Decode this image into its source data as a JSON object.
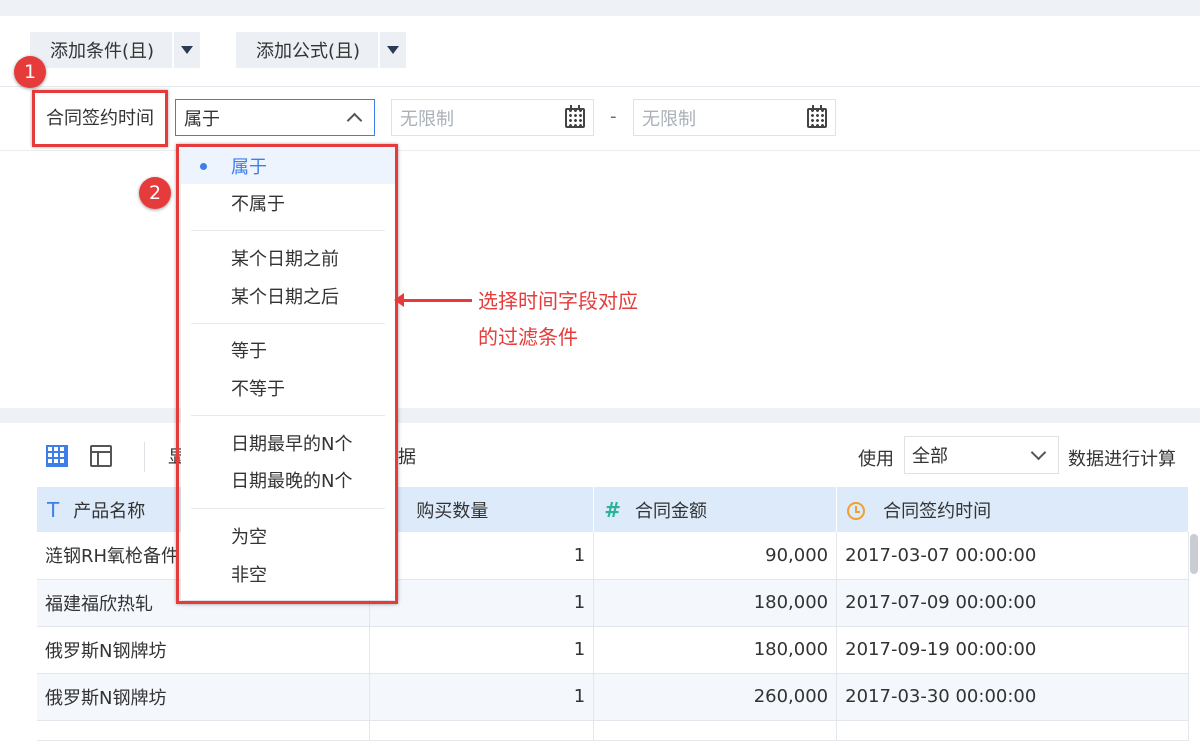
{
  "filter": {
    "add_condition_label": "添加条件(且)",
    "add_formula_label": "添加公式(且)",
    "field_label": "合同签约时间",
    "operator_value": "属于",
    "date_from_placeholder": "无限制",
    "date_to_placeholder": "无限制",
    "range_separator": "-"
  },
  "dropdown": {
    "items": [
      {
        "label": "属于",
        "selected": true
      },
      {
        "label": "不属于"
      },
      {
        "label": "某个日期之前"
      },
      {
        "label": "某个日期之后"
      },
      {
        "label": "等于"
      },
      {
        "label": "不等于"
      },
      {
        "label": "日期最早的N个"
      },
      {
        "label": "日期最晚的N个"
      },
      {
        "label": "为空"
      },
      {
        "label": "非空"
      }
    ]
  },
  "annotations": {
    "badge1": "1",
    "badge2": "2",
    "note_line1": "选择时间字段对应",
    "note_line2": "的过滤条件",
    "color": "#e53b3b"
  },
  "toolbar": {
    "hidden_text_left": "显",
    "hidden_text_right": "据",
    "use_label": "使用",
    "use_value": "全部",
    "calc_label": "数据进行计算"
  },
  "table": {
    "columns": [
      {
        "label": "产品名称",
        "icon": "text-type-icon"
      },
      {
        "label": "购买数量",
        "icon": ""
      },
      {
        "label": "合同金额",
        "icon": "number-type-icon"
      },
      {
        "label": "合同签约时间",
        "icon": "time-type-icon"
      }
    ],
    "rows": [
      [
        "涟钢RH氧枪备件",
        "1",
        "90,000",
        "2017-03-07 00:00:00"
      ],
      [
        "福建福欣热轧",
        "1",
        "180,000",
        "2017-07-09 00:00:00"
      ],
      [
        "俄罗斯N钢牌坊",
        "1",
        "180,000",
        "2017-09-19 00:00:00"
      ],
      [
        "俄罗斯N钢牌坊",
        "1",
        "260,000",
        "2017-03-30 00:00:00"
      ]
    ]
  },
  "colors": {
    "accent": "#3e7ee8",
    "header_bg": "#ddeaf9",
    "highlight": "#e53b3b"
  }
}
